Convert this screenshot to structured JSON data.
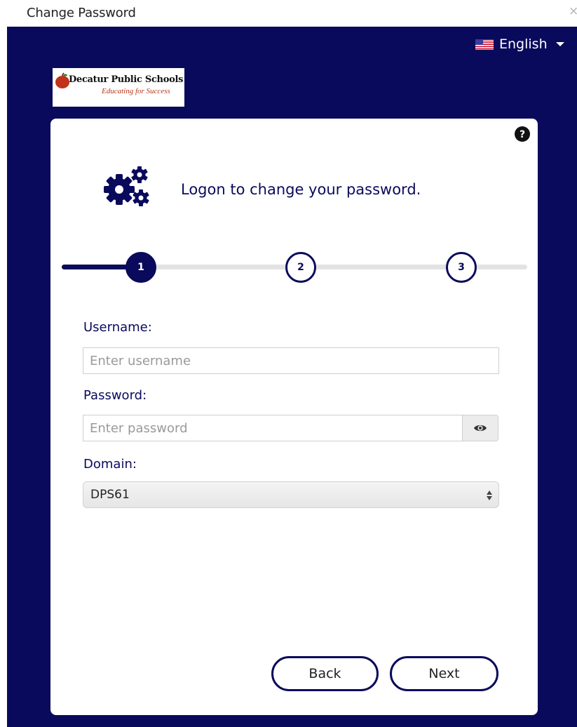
{
  "window": {
    "title": "Change Password",
    "close_symbol": "×"
  },
  "header": {
    "language": "English",
    "flag_icon": "us-flag-icon"
  },
  "logo": {
    "name": "Decatur Public Schools",
    "tagline": "Educating for Success"
  },
  "card": {
    "heading": "Logon to change your password.",
    "help_icon": "question-circle-icon",
    "gears_icon": "gears-icon"
  },
  "steps": {
    "current": 1,
    "items": [
      "1",
      "2",
      "3"
    ]
  },
  "form": {
    "username_label": "Username:",
    "username_placeholder": "Enter username",
    "username_value": "",
    "password_label": "Password:",
    "password_placeholder": "Enter password",
    "password_value": "",
    "domain_label": "Domain:",
    "domain_value": "DPS61"
  },
  "buttons": {
    "back": "Back",
    "next": "Next"
  },
  "colors": {
    "navy": "#0a0a5c",
    "track": "#e3e3e3",
    "logo_red": "#b5361a"
  }
}
